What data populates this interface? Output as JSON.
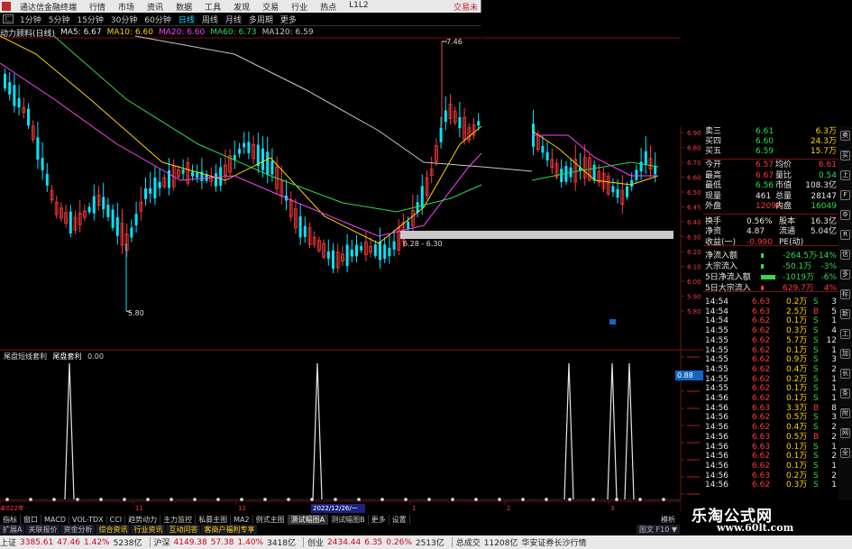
{
  "title_bar": {
    "app_name": "通达信金融终端",
    "menus": [
      "行情",
      "市场",
      "资讯",
      "数据",
      "工具",
      "发现",
      "交易",
      "行业",
      "热点",
      "L1L2"
    ],
    "right_label": "交易未"
  },
  "period_bar": {
    "first_icon": "ㄈ",
    "buttons": [
      "1分钟",
      "5分钟",
      "15分钟",
      "30分钟",
      "60分钟",
      "日线",
      "周线",
      "月线",
      "多周期",
      "更多"
    ],
    "active": "日线"
  },
  "ma_line": {
    "indicator_name": "动力顾料(日线)",
    "items": [
      {
        "label": "MA5: 6.67",
        "color": "#e6e6e6"
      },
      {
        "label": "MA10: 6.60",
        "color": "#ffd400"
      },
      {
        "label": "MA20: 6.60",
        "color": "#ff40ff"
      },
      {
        "label": "MA60: 6.73",
        "color": "#2fdc4a"
      },
      {
        "label": "MA120: 6.59",
        "color": "#c8c8c8"
      }
    ]
  },
  "chart_data": {
    "type": "candlestick",
    "price_axis": {
      "ticks": [
        "6.90",
        "6.80",
        "6.70",
        "6.60",
        "6.50",
        "6.45",
        "6.40",
        "6.30",
        "6.20",
        "6.10",
        "6.00",
        "5.90",
        "5.80"
      ]
    },
    "high_label": "7.46",
    "low_label": "5.80",
    "range_label": "6.28 - 6.30",
    "date_ticks": [
      "2022年",
      "11",
      "12",
      "1",
      "2",
      "3",
      "4"
    ],
    "cursor_date": "2022/12/26/一",
    "indicator": {
      "name": "尾盘短线套利",
      "sub_name": "尾盘套利",
      "value": "0.00",
      "current_value": "0.88"
    }
  },
  "panel": {
    "quotes": [
      {
        "label": "卖三",
        "price": "6.61",
        "vol": "6.3万"
      },
      {
        "label": "买四",
        "price": "6.60",
        "vol": "24.3万"
      },
      {
        "label": "买五",
        "price": "6.59",
        "vol": "15.7万"
      }
    ],
    "stats": [
      {
        "l1": "今开",
        "v1": "6.57",
        "l2": "均价",
        "v2": "6.61"
      },
      {
        "l1": "最高",
        "v1": "6.67",
        "l2": "量比",
        "v2": "0.54"
      },
      {
        "l1": "最低",
        "v1": "6.56",
        "l2": "市值",
        "v2": "108.3亿"
      },
      {
        "l1": "现量",
        "v1": "461",
        "l2": "总量",
        "v2": "28147"
      },
      {
        "l1": "外盘",
        "v1": "12098",
        "l2": "内盘",
        "v2": "16049"
      }
    ],
    "stats2": [
      {
        "l1": "换手",
        "v1": "0.56%",
        "l2": "股本",
        "v2": "16.3亿"
      },
      {
        "l1": "净资",
        "v1": "4.87",
        "l2": "流通",
        "v2": "5.04亿"
      },
      {
        "l1": "收益(一)",
        "v1": "-0.990",
        "l2": "PE(动)",
        "v2": ""
      }
    ],
    "flows": [
      {
        "label": "净流入额",
        "value": "-264.5万",
        "pct": "-14%"
      },
      {
        "label": "大宗流入",
        "value": "-50.1万",
        "pct": "-3%"
      },
      {
        "label": "5日净流入额",
        "value": "-1019万",
        "pct": "-6%"
      },
      {
        "label": "5日大宗流入",
        "value": "629.7万",
        "pct": "4%"
      }
    ],
    "ticks": [
      {
        "time": "14:54",
        "price": "6.63",
        "vol": "0.2万",
        "side": "S",
        "n": "3"
      },
      {
        "time": "14:54",
        "price": "6.63",
        "vol": "2.5万",
        "side": "B",
        "n": "5"
      },
      {
        "time": "14:54",
        "price": "6.62",
        "vol": "0.1万",
        "side": "S",
        "n": "1"
      },
      {
        "time": "14:55",
        "price": "6.62",
        "vol": "0.3万",
        "side": "S",
        "n": "4"
      },
      {
        "time": "14:55",
        "price": "6.62",
        "vol": "5.7万",
        "side": "S",
        "n": "12"
      },
      {
        "time": "14:55",
        "price": "6.62",
        "vol": "0.1万",
        "side": "S",
        "n": "1"
      },
      {
        "time": "14:55",
        "price": "6.62",
        "vol": "0.9万",
        "side": "S",
        "n": "3"
      },
      {
        "time": "14:55",
        "price": "6.62",
        "vol": "0.4万",
        "side": "S",
        "n": "2"
      },
      {
        "time": "14:55",
        "price": "6.62",
        "vol": "0.2万",
        "side": "S",
        "n": "1"
      },
      {
        "time": "14:55",
        "price": "6.62",
        "vol": "0.1万",
        "side": "S",
        "n": "1"
      },
      {
        "time": "14:56",
        "price": "6.62",
        "vol": "0.1万",
        "side": "S",
        "n": "1"
      },
      {
        "time": "14:56",
        "price": "6.63",
        "vol": "3.3万",
        "side": "B",
        "n": "8"
      },
      {
        "time": "14:56",
        "price": "6.62",
        "vol": "0.5万",
        "side": "S",
        "n": "3"
      },
      {
        "time": "14:56",
        "price": "6.62",
        "vol": "0.4万",
        "side": "S",
        "n": "2"
      },
      {
        "time": "14:56",
        "price": "6.63",
        "vol": "0.5万",
        "side": "B",
        "n": "2"
      },
      {
        "time": "14:56",
        "price": "6.63",
        "vol": "0.1万",
        "side": "S",
        "n": "1"
      },
      {
        "time": "14:56",
        "price": "6.62",
        "vol": "0.1万",
        "side": "S",
        "n": "2"
      },
      {
        "time": "14:56",
        "price": "6.62",
        "vol": "0.1万",
        "side": "S",
        "n": "1"
      },
      {
        "time": "14:56",
        "price": "6.63",
        "vol": "0.2万",
        "side": "S",
        "n": "2"
      },
      {
        "time": "14:56",
        "price": "6.62",
        "vol": "0.3万",
        "side": "S",
        "n": "1"
      }
    ]
  },
  "icon_strip": [
    "卖",
    "买",
    "上",
    "F",
    "⚙",
    "R",
    "信",
    "多",
    "标",
    "新",
    "工",
    "加",
    "长",
    "条",
    "附",
    "网",
    "全"
  ],
  "tabs": {
    "items": [
      "指标",
      "窗口",
      "MACD",
      "VOL-TDX",
      "CCI",
      "趋势动力",
      "主力监控",
      "私募主图",
      "MA2",
      "例式主图",
      "测试幅图A",
      "测试幅图B",
      "更多",
      "设置"
    ],
    "active": "测试幅图A",
    "right": "模析"
  },
  "subtabs": {
    "items": [
      "扩展A",
      "关联报价",
      "资金分析",
      "综合资讯",
      "行业资讯",
      "互动问答",
      "客商户福利专享"
    ],
    "hot": [
      "综合资讯",
      "行业资讯",
      "互动问答",
      "客商户福利专享"
    ],
    "right": "图文 F10 ▼"
  },
  "status_bar": {
    "items": [
      {
        "text": "上证",
        "cls": ""
      },
      {
        "text": "3385.61",
        "cls": "st-red"
      },
      {
        "text": "47.46",
        "cls": "st-red"
      },
      {
        "text": "1.42%",
        "cls": "st-red"
      },
      {
        "text": "5238亿",
        "cls": ""
      },
      {
        "text": "沪深",
        "cls": ""
      },
      {
        "text": "4149.38",
        "cls": "st-red"
      },
      {
        "text": "57.38",
        "cls": "st-red"
      },
      {
        "text": "1.40%",
        "cls": "st-red"
      },
      {
        "text": "3418亿",
        "cls": ""
      },
      {
        "text": "创业",
        "cls": ""
      },
      {
        "text": "2434.44",
        "cls": "st-red"
      },
      {
        "text": "6.35",
        "cls": "st-red"
      },
      {
        "text": "0.26%",
        "cls": "st-red"
      },
      {
        "text": "2513亿",
        "cls": ""
      },
      {
        "text": "总成交",
        "cls": ""
      },
      {
        "text": "11208亿",
        "cls": ""
      },
      {
        "text": "华安证券长沙行情",
        "cls": ""
      }
    ]
  },
  "watermark": {
    "cn": "乐淘公式网",
    "url": "www.60lt.com"
  },
  "colors": {
    "up": "#ff3b3b",
    "down": "#00e5ff",
    "panel_red": "#ff3b3b",
    "panel_green": "#2fdc4a"
  }
}
